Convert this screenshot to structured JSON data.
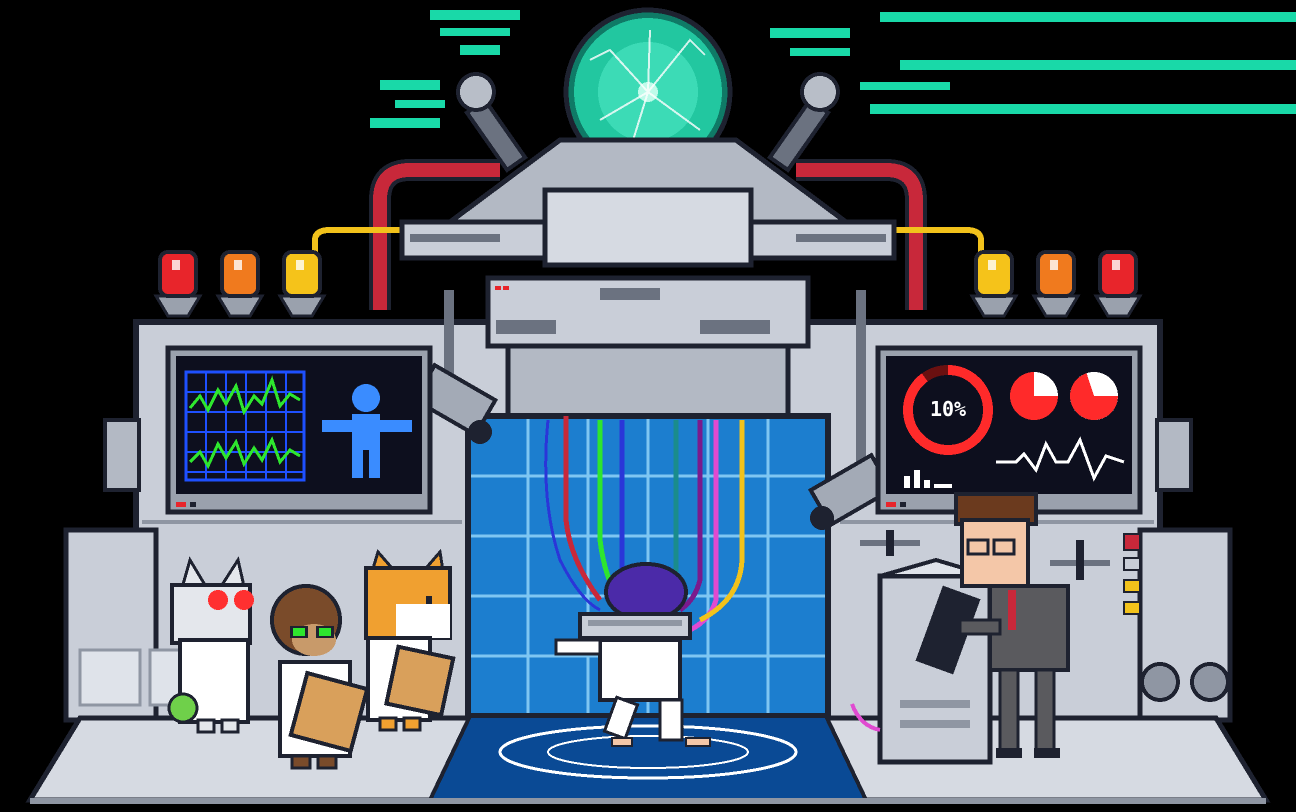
{
  "scene": {
    "kind": "pixel-art laboratory illustration",
    "colors": {
      "background": "#000000",
      "machine": "#c9ced8",
      "machine_dark": "#8f96a3",
      "outline": "#1e2230",
      "screen": "#0d0f1e",
      "portal": "#1c7ecf",
      "portal_grid": "#7fc6f2",
      "floor": "#d6dae2",
      "floor_pad": "#0a4a95",
      "electric": "#19d9a8",
      "cable_red": "#c8283a",
      "cable_yellow": "#f2c21b"
    }
  },
  "left_monitor": {
    "waveform_color": "#2ee62e",
    "grid_color": "#1e50ff",
    "figure_color": "#3a8cff"
  },
  "right_monitor": {
    "gauge_percent": 10,
    "gauge_label": "10%",
    "accent_color": "#ff2a2a"
  },
  "warning_lights": {
    "left": [
      "#e8252b",
      "#f07a1e",
      "#f5c31a"
    ],
    "right": [
      "#f5c31a",
      "#f07a1e",
      "#e8252b"
    ]
  },
  "characters": [
    {
      "name": "cat-scientist",
      "note_color": "#ff3030"
    },
    {
      "name": "monkey-scientist"
    },
    {
      "name": "shiba-scientist"
    },
    {
      "name": "test-subject"
    },
    {
      "name": "human-scientist"
    }
  ]
}
